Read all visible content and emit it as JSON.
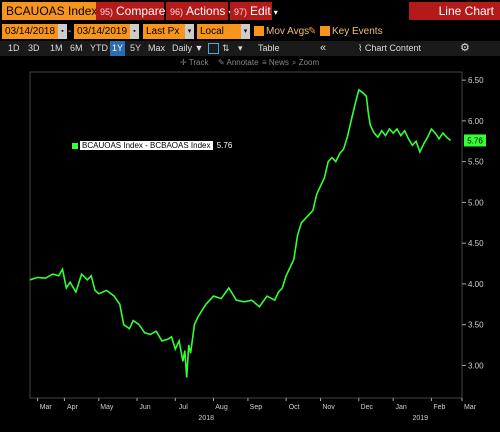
{
  "header": {
    "ticker": "BCAUOAS Index",
    "compare": {
      "num": "95)",
      "label": "Compare"
    },
    "actions": {
      "num": "96)",
      "label": "Actions"
    },
    "edit": {
      "num": "97)",
      "label": "Edit"
    },
    "title": "Line Chart"
  },
  "controls": {
    "start_date": "03/14/2018",
    "end_date": "03/14/2019",
    "price_field": "Last Px",
    "currency": "Local CCY",
    "mov_avgs": "Mov Avgs",
    "key_events": "Key Events"
  },
  "periods": [
    "1D",
    "3D",
    "1M",
    "6M",
    "YTD",
    "1Y",
    "5Y",
    "Max"
  ],
  "selected_period": "1Y",
  "frequency": "Daily",
  "table_label": "Table",
  "chart_content_label": "Chart Content",
  "tools": [
    "Track",
    "Annotate",
    "News",
    "Zoom"
  ],
  "colors": {
    "line": "#33ff33",
    "accent": "#f7941d",
    "menu": "#b31b1b"
  },
  "icons": {
    "settings": "gear-icon",
    "collapse": "double-chevron-left-icon"
  },
  "chart_data": {
    "type": "line",
    "legend": "BCAUOAS Index - BCBAOAS Index",
    "last_value": "5.76",
    "ylim": [
      2.6,
      6.6
    ],
    "yticks": [
      "6.50",
      "6.00",
      "5.50",
      "5.00",
      "4.50",
      "4.00",
      "3.50",
      "3.00"
    ],
    "ytick_values": [
      6.5,
      6.0,
      5.5,
      5.0,
      4.5,
      4.0,
      3.5,
      3.0
    ],
    "xticks": [
      "Mar",
      "Apr",
      "May",
      "Jun",
      "Jul",
      "Aug",
      "Sep",
      "Oct",
      "Nov",
      "Dec",
      "Jan",
      "Feb",
      "Mar"
    ],
    "xtick_positions": [
      0.02,
      0.09,
      0.18,
      0.28,
      0.38,
      0.48,
      0.57,
      0.67,
      0.76,
      0.86,
      0.95,
      1.05,
      1.13
    ],
    "years": [
      "2018",
      "2019"
    ],
    "year_positions": [
      0.44,
      1.0
    ],
    "series": [
      {
        "x": [
          0,
          0.02,
          0.04,
          0.06,
          0.075,
          0.085,
          0.095,
          0.105,
          0.12,
          0.135,
          0.15,
          0.16,
          0.17,
          0.18,
          0.2,
          0.22,
          0.235,
          0.245,
          0.26,
          0.27,
          0.285,
          0.3,
          0.315,
          0.33,
          0.345,
          0.36,
          0.37,
          0.38,
          0.39,
          0.4,
          0.405,
          0.41,
          0.415,
          0.42,
          0.43,
          0.44,
          0.46,
          0.48,
          0.5,
          0.52,
          0.54,
          0.56,
          0.58,
          0.6,
          0.62,
          0.64,
          0.65,
          0.66,
          0.67,
          0.68,
          0.69,
          0.7,
          0.71,
          0.72,
          0.73,
          0.74,
          0.75,
          0.76,
          0.77,
          0.78,
          0.79,
          0.8,
          0.81,
          0.82,
          0.83,
          0.84,
          0.85,
          0.86,
          0.87,
          0.88,
          0.885,
          0.89,
          0.9,
          0.91,
          0.92,
          0.93,
          0.94,
          0.95,
          0.96,
          0.97,
          0.98,
          0.99,
          1.0,
          1.01,
          1.02,
          1.03,
          1.04,
          1.05,
          1.06,
          1.07,
          1.08,
          1.09,
          1.1
        ],
        "y": [
          4.05,
          4.08,
          4.07,
          4.12,
          4.1,
          4.18,
          3.95,
          4.02,
          3.9,
          4.12,
          4.05,
          4.1,
          3.92,
          3.88,
          3.92,
          3.85,
          3.75,
          3.5,
          3.45,
          3.55,
          3.5,
          3.4,
          3.38,
          3.42,
          3.3,
          3.32,
          3.35,
          3.2,
          3.3,
          3.05,
          3.18,
          2.85,
          3.25,
          3.15,
          3.5,
          3.6,
          3.75,
          3.85,
          3.82,
          3.95,
          3.8,
          3.78,
          3.8,
          3.72,
          3.85,
          3.8,
          3.9,
          3.95,
          4.1,
          4.2,
          4.3,
          4.6,
          4.75,
          4.8,
          4.85,
          4.9,
          5.1,
          5.2,
          5.3,
          5.5,
          5.55,
          5.5,
          5.6,
          5.65,
          5.8,
          6.0,
          6.2,
          6.38,
          6.35,
          6.3,
          6.1,
          5.95,
          5.85,
          5.8,
          5.88,
          5.82,
          5.9,
          5.85,
          5.9,
          5.82,
          5.88,
          5.78,
          5.7,
          5.75,
          5.62,
          5.72,
          5.8,
          5.9,
          5.85,
          5.78,
          5.85,
          5.8,
          5.76
        ]
      }
    ]
  }
}
